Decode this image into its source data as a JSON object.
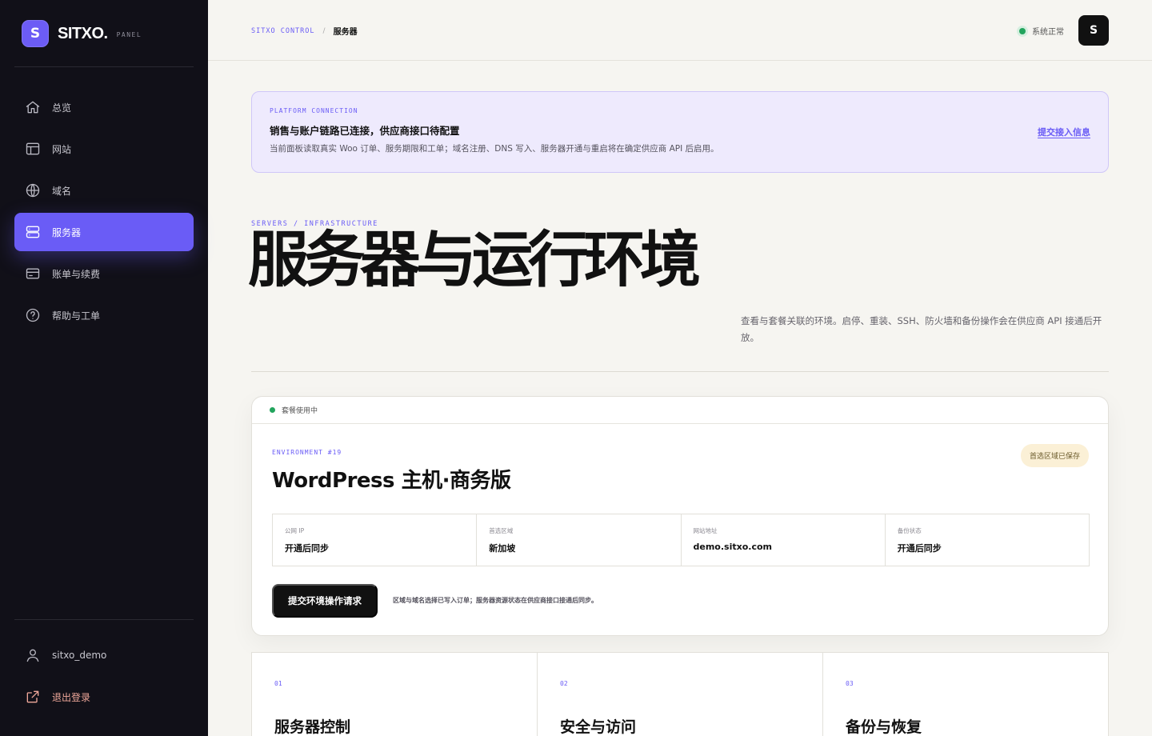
{
  "brand": {
    "logo_letter": "S",
    "name": "SITXO.",
    "tag": "PANEL"
  },
  "sidebar": {
    "items": [
      {
        "label": "总览",
        "icon": "home-icon"
      },
      {
        "label": "网站",
        "icon": "layout-icon"
      },
      {
        "label": "域名",
        "icon": "globe-icon"
      },
      {
        "label": "服务器",
        "icon": "server-icon",
        "active": true
      },
      {
        "label": "账单与续费",
        "icon": "card-icon"
      },
      {
        "label": "帮助与工单",
        "icon": "help-icon"
      }
    ],
    "user": "sitxo_demo",
    "logout": "退出登录"
  },
  "topbar": {
    "crumb_root": "SITXO CONTROL",
    "crumb_sep": "/",
    "crumb_current": "服务器",
    "status": "系统正常",
    "avatar": "S"
  },
  "banner": {
    "tag": "PLATFORM CONNECTION",
    "title": "销售与账户链路已连接，供应商接口待配置",
    "desc": "当前面板读取真实 Woo 订单、服务期限和工单；域名注册、DNS 写入、服务器开通与重启将在确定供应商 API 后启用。",
    "link": "提交接入信息"
  },
  "hero": {
    "tag": "SERVERS / INFRASTRUCTURE",
    "title": "服务器与运行环境",
    "desc": "查看与套餐关联的环境。启停、重装、SSH、防火墙和备份操作会在供应商 API 接通后开放。"
  },
  "env": {
    "status": "套餐使用中",
    "id": "ENVIRONMENT #19",
    "title": "WordPress 主机·商务版",
    "pill": "首选区域已保存",
    "stats": [
      {
        "label": "公网 IP",
        "value": "开通后同步"
      },
      {
        "label": "首选区域",
        "value": "新加坡"
      },
      {
        "label": "网站地址",
        "value": "demo.sitxo.com"
      },
      {
        "label": "备份状态",
        "value": "开通后同步"
      }
    ],
    "button": "提交环境操作请求",
    "note": "区域与域名选择已写入订单；服务器资源状态在供应商接口接通后同步。"
  },
  "features": [
    {
      "num": "01",
      "title": "服务器控制"
    },
    {
      "num": "02",
      "title": "安全与访问"
    },
    {
      "num": "03",
      "title": "备份与恢复"
    }
  ],
  "colors": {
    "accent": "#6a5cf6",
    "sidebar_bg": "#111018",
    "page_bg": "#f6f5f1",
    "status_green": "#22a45d"
  }
}
